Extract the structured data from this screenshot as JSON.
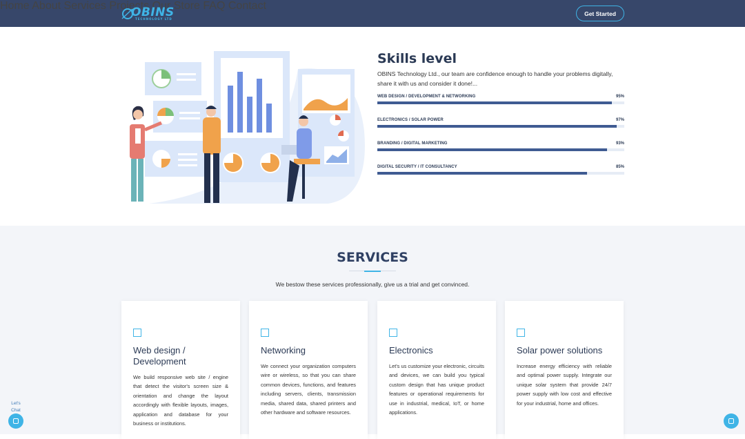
{
  "header": {
    "logo_text": "OBINS",
    "logo_sub": "TECHNOLOGY LTD",
    "nav": [
      "Home",
      "About",
      "Services",
      "Projects",
      "Our Store",
      "FAQ",
      "Contact"
    ],
    "cta": "Get Started"
  },
  "skills": {
    "title": "Skills level",
    "description": "OBINS Technology Ltd., our team are confidence enough to handle your problems digitally, share it with us and consider it done!...",
    "items": [
      {
        "label": "WEB DESIGN / DEVELOPMENT & NETWORKING",
        "percent_text": "95%",
        "value": 95
      },
      {
        "label": "ELECTRONICS / SOLAR POWER",
        "percent_text": "97%",
        "value": 97
      },
      {
        "label": "BRANDING / DIGITAL MARKETING",
        "percent_text": "93%",
        "value": 93
      },
      {
        "label": "DIGITAL SECURITY / IT CONSULTANCY",
        "percent_text": "85%",
        "value": 85
      }
    ],
    "bar_color": "#3f5b92"
  },
  "services": {
    "title": "SERVICES",
    "subtitle": "We bestow these services professionally, give us a trial and get convinced.",
    "cards": [
      {
        "title": "Web design / Development",
        "text": "We build responsive web site / engine that detect the visitor's screen size & orientation and change the layout accordingly with flexible layouts, images, application and database for your business or institutions."
      },
      {
        "title": "Networking",
        "text": "We connect your organization computers wire or wireless, so that you can share common devices, functions, and features including servers, clients, transmission media, shared data, shared printers and other hardware and software resources."
      },
      {
        "title": "Electronics",
        "text": "Let's us customize your electronic, circuits and devices, we can build you typical custom design that has unique product features or operational requirements for use in industrial, medical, IoT, or home applications."
      },
      {
        "title": "Solar power solutions",
        "text": "Increase energy efficiency with reliable and optimal power supply. Integrate our unique solar system that provide 24/7 power supply with low cost and effective for your industrial, home and offices."
      }
    ]
  },
  "chat": {
    "label": "Let's Chat"
  },
  "colors": {
    "header_bg": "#37476a",
    "accent": "#3fb4e6",
    "heading": "#2b3a55"
  }
}
